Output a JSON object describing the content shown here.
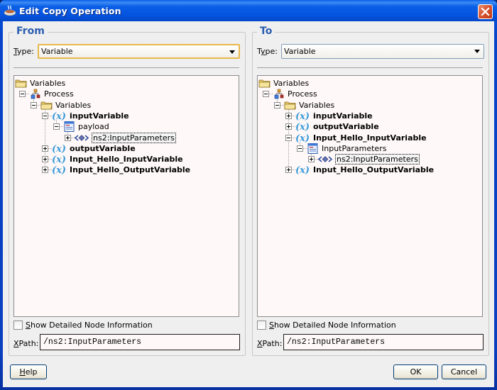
{
  "window": {
    "title": "Edit Copy Operation",
    "icon": "coffee-cup-icon",
    "close_icon": "close-icon"
  },
  "from": {
    "legend": "From",
    "type_label_mnemonic": "T",
    "type_label_rest": "ype:",
    "type_value": "Variable",
    "tree": [
      {
        "label": "Variables",
        "icon": "folder-icon",
        "bold": false,
        "expander": "none",
        "level": 0
      },
      {
        "label": "Process",
        "icon": "process-icon",
        "bold": false,
        "expander": "minus",
        "level": 1
      },
      {
        "label": "Variables",
        "icon": "folder-icon",
        "bold": false,
        "expander": "minus",
        "level": 2
      },
      {
        "label": "inputVariable",
        "icon": "variable-icon",
        "bold": true,
        "expander": "minus",
        "level": 3
      },
      {
        "label": "payload",
        "icon": "message-part-icon",
        "bold": false,
        "expander": "minus",
        "level": 4
      },
      {
        "label": "ns2:InputParameters",
        "icon": "element-icon",
        "bold": false,
        "expander": "plus",
        "level": 5,
        "selected": true
      },
      {
        "label": "outputVariable",
        "icon": "variable-icon",
        "bold": true,
        "expander": "plus",
        "level": 3
      },
      {
        "label": "Input_Hello_InputVariable",
        "icon": "variable-icon",
        "bold": true,
        "expander": "plus",
        "level": 3
      },
      {
        "label": "Input_Hello_OutputVariable",
        "icon": "variable-icon",
        "bold": true,
        "expander": "plus",
        "level": 3
      }
    ],
    "show_detail_mnemonic": "S",
    "show_detail_rest": "how Detailed Node Information",
    "show_detail_checked": false,
    "xpath_mnemonic": "X",
    "xpath_rest": "Path:",
    "xpath_value": "/ns2:InputParameters"
  },
  "to": {
    "legend": "To",
    "type_label_mnemonic": "y",
    "type_label_pre": "T",
    "type_label_rest": "pe:",
    "type_value": "Variable",
    "tree": [
      {
        "label": "Variables",
        "icon": "folder-icon",
        "bold": false,
        "expander": "none",
        "level": 0
      },
      {
        "label": "Process",
        "icon": "process-icon",
        "bold": false,
        "expander": "minus",
        "level": 1
      },
      {
        "label": "Variables",
        "icon": "folder-icon",
        "bold": false,
        "expander": "minus",
        "level": 2
      },
      {
        "label": "inputVariable",
        "icon": "variable-icon",
        "bold": true,
        "expander": "plus",
        "level": 3
      },
      {
        "label": "outputVariable",
        "icon": "variable-icon",
        "bold": true,
        "expander": "plus",
        "level": 3
      },
      {
        "label": "Input_Hello_InputVariable",
        "icon": "variable-icon",
        "bold": true,
        "expander": "minus",
        "level": 3
      },
      {
        "label": "InputParameters",
        "icon": "message-part-icon",
        "bold": false,
        "expander": "minus",
        "level": 4
      },
      {
        "label": "ns2:InputParameters",
        "icon": "element-icon",
        "bold": false,
        "expander": "plus",
        "level": 5,
        "selected": true
      },
      {
        "label": "Input_Hello_OutputVariable",
        "icon": "variable-icon",
        "bold": true,
        "expander": "plus",
        "level": 3
      }
    ],
    "show_detail_mnemonic": "S",
    "show_detail_rest": "how Detailed Node Information",
    "show_detail_checked": false,
    "xpath_mnemonic": "X",
    "xpath_rest": "Path:",
    "xpath_value": "/ns2:InputParameters"
  },
  "buttons": {
    "help_mnemonic": "H",
    "help_rest": "elp",
    "ok": "OK",
    "cancel": "Cancel"
  },
  "colors": {
    "title_bar": "#0554e0",
    "legend": "#2a5db0",
    "tree_bg": "#fff8f8",
    "focus_border": "#e8b84a"
  }
}
